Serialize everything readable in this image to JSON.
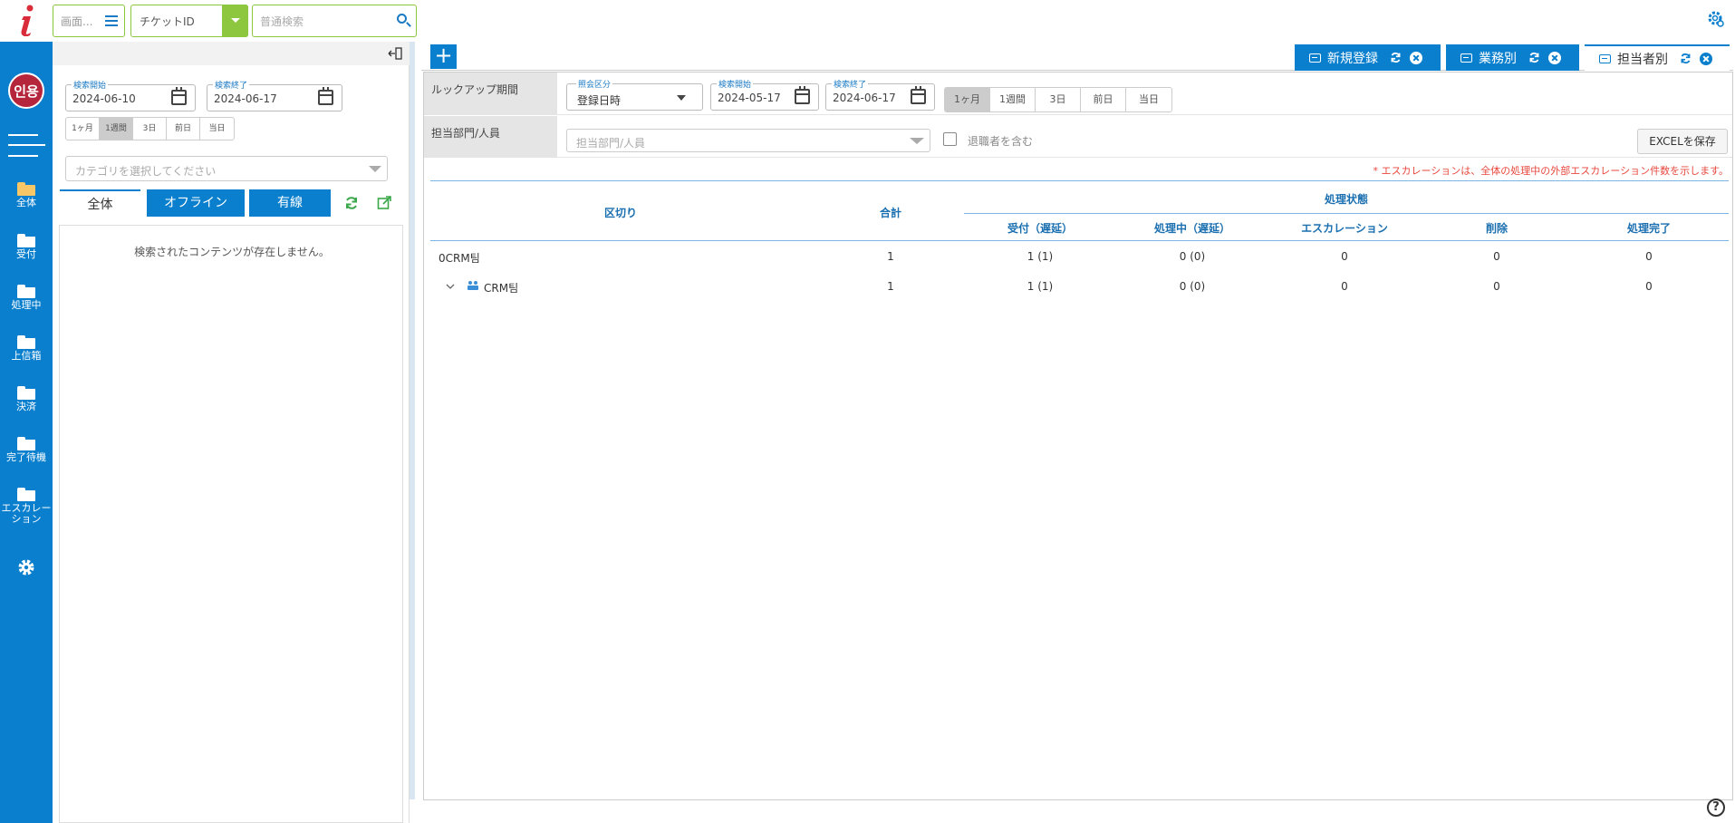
{
  "topbar": {
    "logo": "i",
    "screen_select": "画面...",
    "ticket_select": "チケットID",
    "search_placeholder": "普通検索",
    "settings_icon": "gear-icon"
  },
  "colors": {
    "primary": "#0a7fce",
    "accent": "#8dc63f",
    "note": "#e8473c",
    "avatar": "#b5253b"
  },
  "leftnav": {
    "avatar": "인용",
    "items": [
      {
        "label": "全体"
      },
      {
        "label": "受付"
      },
      {
        "label": "処理中"
      },
      {
        "label": "上信箱"
      },
      {
        "label": "決済"
      },
      {
        "label": "完了待機"
      },
      {
        "label": "エスカレーション"
      }
    ]
  },
  "leftpanel": {
    "start_label": "検索開始",
    "start_value": "2024-06-10",
    "end_label": "検索終了",
    "end_value": "2024-06-17",
    "ranges": [
      "1ヶ月",
      "1週間",
      "3日",
      "前日",
      "当日"
    ],
    "selected_range": "1週間",
    "category_placeholder": "カテゴリを選択してください",
    "filters": [
      "全体",
      "オフライン",
      "有線"
    ],
    "empty_message": "検索されたコンテンツが存在しません。"
  },
  "tabs": [
    {
      "label": "新規登録"
    },
    {
      "label": "業務別"
    },
    {
      "label": "担当者別"
    }
  ],
  "main": {
    "lookup_label": "ルックアップ期間",
    "inquiry_label": "照会区分",
    "inquiry_value": "登録日時",
    "start_label": "検索開始",
    "start_value": "2024-05-17",
    "end_label": "検索終了",
    "end_value": "2024-06-17",
    "ranges": [
      "1ヶ月",
      "1週間",
      "3日",
      "前日",
      "当日"
    ],
    "selected_range": "1ヶ月",
    "dept_label": "担当部門/人員",
    "dept_placeholder": "担当部門/人員",
    "retired_label": "退職者を含む",
    "excel_button": "EXCELを保存",
    "note": "* エスカレーションは、全体の処理中の外部エスカレーション件数を示します。"
  },
  "table": {
    "headers": {
      "division": "区切り",
      "total": "合計",
      "status_group": "処理状態",
      "received": "受付（遅延）",
      "processing": "処理中（遅延）",
      "escalation": "エスカレーション",
      "deleted": "削除",
      "completed": "処理完了"
    },
    "rows": [
      {
        "name": "0CRM팀",
        "total": "1",
        "received": "1 (1)",
        "processing": "0 (0)",
        "escalation": "0",
        "deleted": "0",
        "completed": "0"
      },
      {
        "name": "CRM팀",
        "total": "1",
        "received": "1 (1)",
        "processing": "0 (0)",
        "escalation": "0",
        "deleted": "0",
        "completed": "0"
      }
    ]
  },
  "help": "?"
}
